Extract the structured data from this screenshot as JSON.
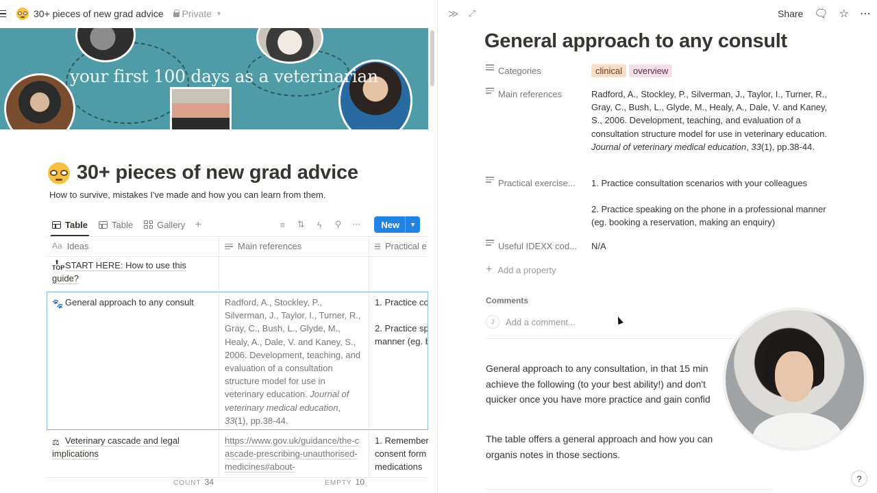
{
  "topbar": {
    "page_title": "30+ pieces of new grad advice",
    "privacy": "Private"
  },
  "banner": {
    "script_text": "your first 100 days as a veterinarian"
  },
  "page": {
    "title": "30+ pieces of new grad advice",
    "description": "How to survive, mistakes I've made and how you can learn from them."
  },
  "views": {
    "tabs": [
      {
        "label": "Table",
        "active": true
      },
      {
        "label": "Table",
        "active": false
      },
      {
        "label": "Gallery",
        "active": false
      }
    ],
    "new_label": "New"
  },
  "table": {
    "columns": [
      "Ideas",
      "Main references",
      "Practical e"
    ],
    "rows": [
      {
        "idea": "START HERE: How to use this guide?",
        "refs": "",
        "practical": ""
      },
      {
        "idea": "General approach to any consult",
        "refs_plain": "Radford, A., Stockley, P., Silverman, J., Taylor, I., Turner, R., Gray, C., Bush, L., Glyde, M., Healy, A., Dale, V. and Kaney, S., 2006. Development, teaching, and evaluation of a consultation structure model for use in ",
        "refs_journal": "veterinary education. ",
        "refs_italic": "Journal of veterinary medical education",
        "refs_sep": ", ",
        "refs_vol": "33",
        "refs_end": "(1), pp.38-44.",
        "practical_1": "1. Practice co",
        "practical_2": "2. Practice sp",
        "practical_3": "manner (eg. b"
      },
      {
        "idea": "Veterinary cascade and legal implications",
        "refs": "https://www.gov.uk/guidance/the-cascade-prescribing-unauthorised-medicines#about-",
        "practical_1": "1. Remember",
        "practical_2": "consent form",
        "practical_3": "medications"
      }
    ]
  },
  "footer": {
    "count_label": "COUNT",
    "count_value": "34",
    "empty_label": "EMPTY",
    "empty_value": "10"
  },
  "right": {
    "share_label": "Share",
    "title": "General approach to any consult",
    "properties": {
      "categories_label": "Categories",
      "tags": [
        {
          "label": "clinical",
          "bg": "#fadec9",
          "fg": "#73390f"
        },
        {
          "label": "overview",
          "bg": "#f5e0e9",
          "fg": "#6c2548"
        }
      ],
      "refs_label": "Main references",
      "refs_plain": "Radford, A., Stockley, P., Silverman, J., Taylor, I., Turner, R., Gray, C., Bush, L., Glyde, M., Healy, A., Dale, V. and Kaney, S., 2006. Development, teaching, and evaluation of a consultation structure model for use in veterinary education. ",
      "refs_italic": "Journal of veterinary medical education",
      "refs_sep": ", ",
      "refs_vol": "33",
      "refs_end": "(1), pp.38-44.",
      "practical_label": "Practical exercise...",
      "practical_1": "1. Practice consultation scenarios with your colleagues",
      "practical_2": "2. Practice speaking on the phone in a professional manner (eg. booking a reservation, making an enquiry)",
      "idexx_label": "Useful IDEXX cod...",
      "idexx_value": "N/A",
      "add_property": "Add a property"
    },
    "comments_label": "Comments",
    "comment_avatar": "J",
    "comment_placeholder": "Add a comment...",
    "body_1": "General approach to any consultation, in that 15 min achieve the following (to your best ability!) and don't quicker once you have more practice and gain confid",
    "body_2": "The table offers a general approach and how you can organis notes in those sections.",
    "help_icon": "?"
  },
  "colors": {
    "accent": "#2383e2",
    "banner": "#4f9ca8"
  }
}
